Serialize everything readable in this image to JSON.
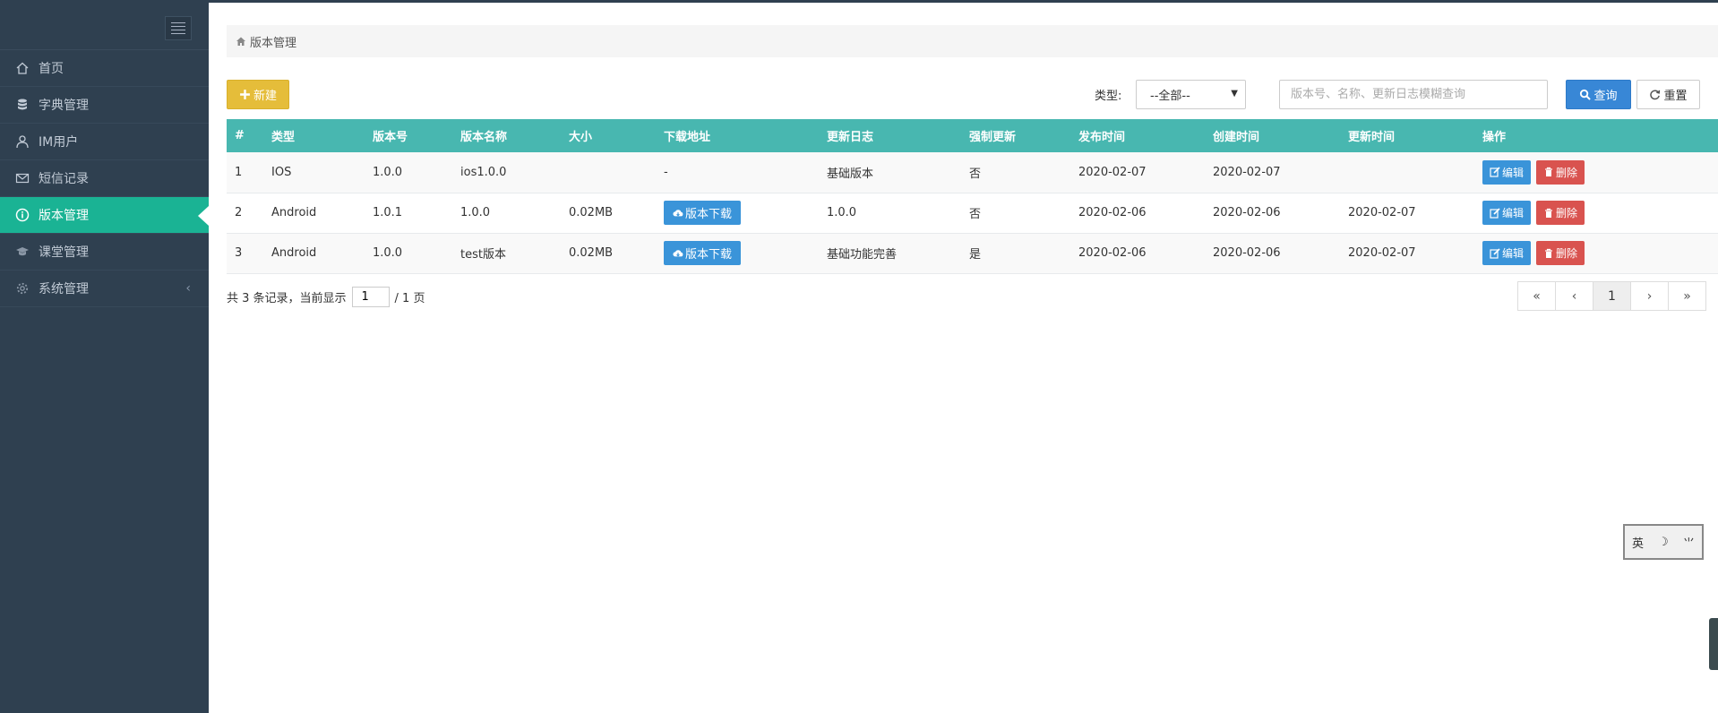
{
  "sidebar": {
    "items": [
      {
        "label": "首页",
        "icon": "home-icon"
      },
      {
        "label": "字典管理",
        "icon": "database-icon"
      },
      {
        "label": "IM用户",
        "icon": "user-icon"
      },
      {
        "label": "短信记录",
        "icon": "envelope-icon"
      },
      {
        "label": "版本管理",
        "icon": "info-icon",
        "active": true
      },
      {
        "label": "课堂管理",
        "icon": "graduation-cap-icon"
      },
      {
        "label": "系统管理",
        "icon": "gear-icon",
        "chevron": "‹"
      }
    ]
  },
  "breadcrumb": {
    "label": "版本管理",
    "icon": "home-icon"
  },
  "toolbar": {
    "new_label": "新建",
    "type_label": "类型:",
    "type_selected": "--全部--",
    "search_placeholder": "版本号、名称、更新日志模糊查询",
    "query_label": "查询",
    "reset_label": "重置"
  },
  "table": {
    "headers": [
      "#",
      "类型",
      "版本号",
      "版本名称",
      "大小",
      "下载地址",
      "更新日志",
      "强制更新",
      "发布时间",
      "创建时间",
      "更新时间",
      "操作"
    ],
    "rows": [
      {
        "no": "1",
        "type": "IOS",
        "version": "1.0.0",
        "name": "ios1.0.0",
        "size": "",
        "download": "-",
        "log": "基础版本",
        "force": "否",
        "published": "2020-02-07",
        "created": "2020-02-07",
        "updated": ""
      },
      {
        "no": "2",
        "type": "Android",
        "version": "1.0.1",
        "name": "1.0.0",
        "size": "0.02MB",
        "download": "版本下载",
        "log": "1.0.0",
        "force": "否",
        "published": "2020-02-06",
        "created": "2020-02-06",
        "updated": "2020-02-07"
      },
      {
        "no": "3",
        "type": "Android",
        "version": "1.0.0",
        "name": "test版本",
        "size": "0.02MB",
        "download": "版本下载",
        "log": "基础功能完善",
        "force": "是",
        "published": "2020-02-06",
        "created": "2020-02-06",
        "updated": "2020-02-07"
      }
    ],
    "edit_label": "编辑",
    "delete_label": "删除"
  },
  "pagination": {
    "info_prefix": "共 3 条记录，当前显示",
    "current_page": "1",
    "info_suffix": "/ 1 页",
    "buttons": [
      "«",
      "‹",
      "1",
      "›",
      "»"
    ]
  },
  "ime_widget": {
    "chars": [
      "英",
      "☽",
      "⺌"
    ]
  },
  "colors": {
    "sidebar_bg": "#2f4050",
    "active": "#1ab394",
    "table_header": "#48b7b0",
    "primary": "#3a94d9",
    "danger": "#d9534f",
    "warning": "#e5bd3a"
  }
}
